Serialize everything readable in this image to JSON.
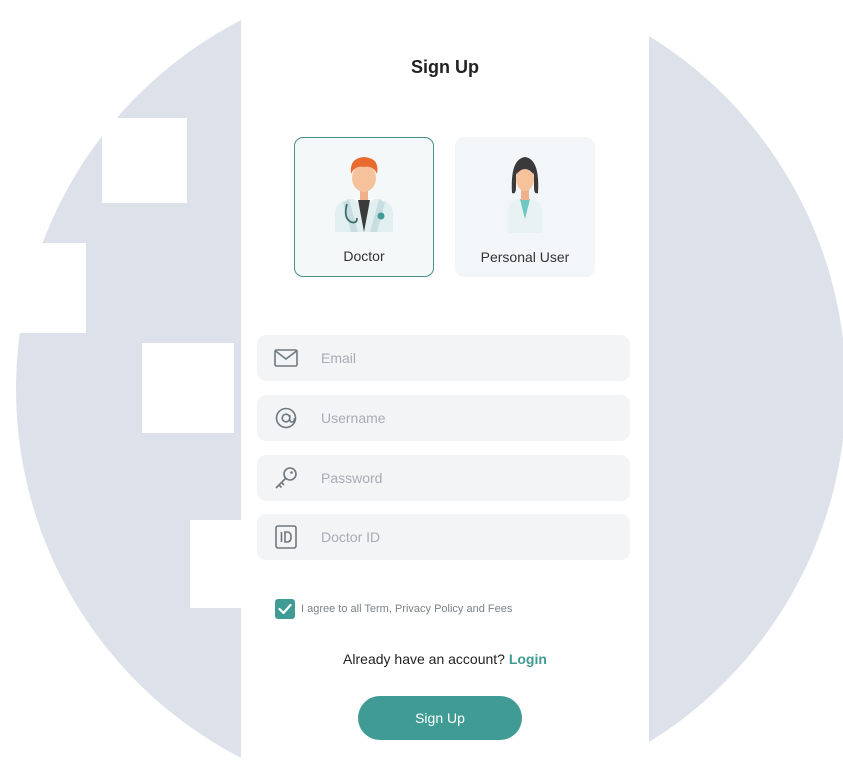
{
  "title": "Sign Up",
  "roles": [
    {
      "label": "Doctor",
      "selected": true
    },
    {
      "label": "Personal User",
      "selected": false
    }
  ],
  "fields": {
    "email": {
      "placeholder": "Email",
      "icon": "mail-icon"
    },
    "username": {
      "placeholder": "Username",
      "icon": "at-icon"
    },
    "password": {
      "placeholder": "Password",
      "icon": "key-icon"
    },
    "doctor_id": {
      "placeholder": "Doctor ID",
      "icon": "id-icon"
    }
  },
  "agreement": {
    "checked": true,
    "text": "I agree to all Term, Privacy Policy and Fees"
  },
  "login_prompt": {
    "text": "Already have an account?",
    "link": "Login"
  },
  "submit_label": "Sign Up",
  "colors": {
    "accent": "#3f9b93",
    "background_circle": "#dde2ea"
  }
}
